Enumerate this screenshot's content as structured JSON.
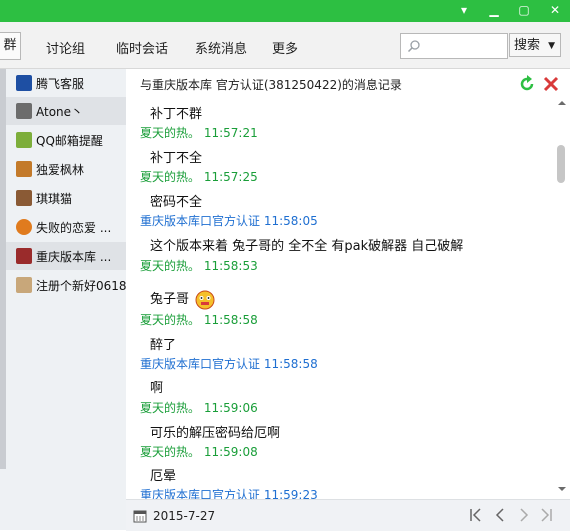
{
  "toolbar": {
    "left_label": "群",
    "tabs": [
      "讨论组",
      "临时会话",
      "系统消息",
      "更多"
    ],
    "search_placeholder": "",
    "search_button": "搜索"
  },
  "contacts": [
    {
      "name": "腾飞客服"
    },
    {
      "name": "Atone丶"
    },
    {
      "name": "QQ邮箱提醒"
    },
    {
      "name": "独爱枫林"
    },
    {
      "name": "琪琪猫"
    },
    {
      "name": "失败的恋爱 ..."
    },
    {
      "name": "重庆版本库 ..."
    },
    {
      "name": "注册个新好0618"
    }
  ],
  "header": {
    "title": "与重庆版本库  官方认证(381250422)的消息记录"
  },
  "messages": [
    {
      "kind": "text",
      "text": "补丁不群"
    },
    {
      "kind": "meta",
      "text": "夏天的热。 11:57:21",
      "color": "#1a9e39"
    },
    {
      "kind": "text",
      "text": "补丁不全"
    },
    {
      "kind": "meta",
      "text": "夏天的热。 11:57:25",
      "color": "#1a9e39"
    },
    {
      "kind": "text",
      "text": "密码不全"
    },
    {
      "kind": "meta",
      "text": "重庆版本库口官方认证 11:58:05",
      "color": "#1f6fd1"
    },
    {
      "kind": "text",
      "text": "这个版本来着 兔子哥的 全不全 有pak破解器 自己破解"
    },
    {
      "kind": "meta",
      "text": "夏天的热。 11:58:53",
      "color": "#1a9e39"
    },
    {
      "kind": "text",
      "text": "兔子哥"
    },
    {
      "kind": "meta",
      "text": "夏天的热。 11:58:58",
      "color": "#1a9e39"
    },
    {
      "kind": "text",
      "text": "醉了"
    },
    {
      "kind": "meta",
      "text": "重庆版本库口官方认证 11:58:58",
      "color": "#1f6fd1"
    },
    {
      "kind": "text",
      "text": "啊"
    },
    {
      "kind": "meta",
      "text": "夏天的热。 11:59:06",
      "color": "#1a9e39"
    },
    {
      "kind": "text",
      "text": "可乐的解压密码给厄啊"
    },
    {
      "kind": "meta",
      "text": "夏天的热。 11:59:08",
      "color": "#1a9e39"
    },
    {
      "kind": "text",
      "text": "厄晕"
    },
    {
      "kind": "meta",
      "text": "重庆版本库口官方认证 11:59:23",
      "color": "#1f6fd1"
    }
  ],
  "bottom": {
    "date": "2015-7-27"
  },
  "colors": {
    "accent": "#2dbf42",
    "sender_self": "#1a9e39",
    "sender_other": "#1f6fd1"
  }
}
